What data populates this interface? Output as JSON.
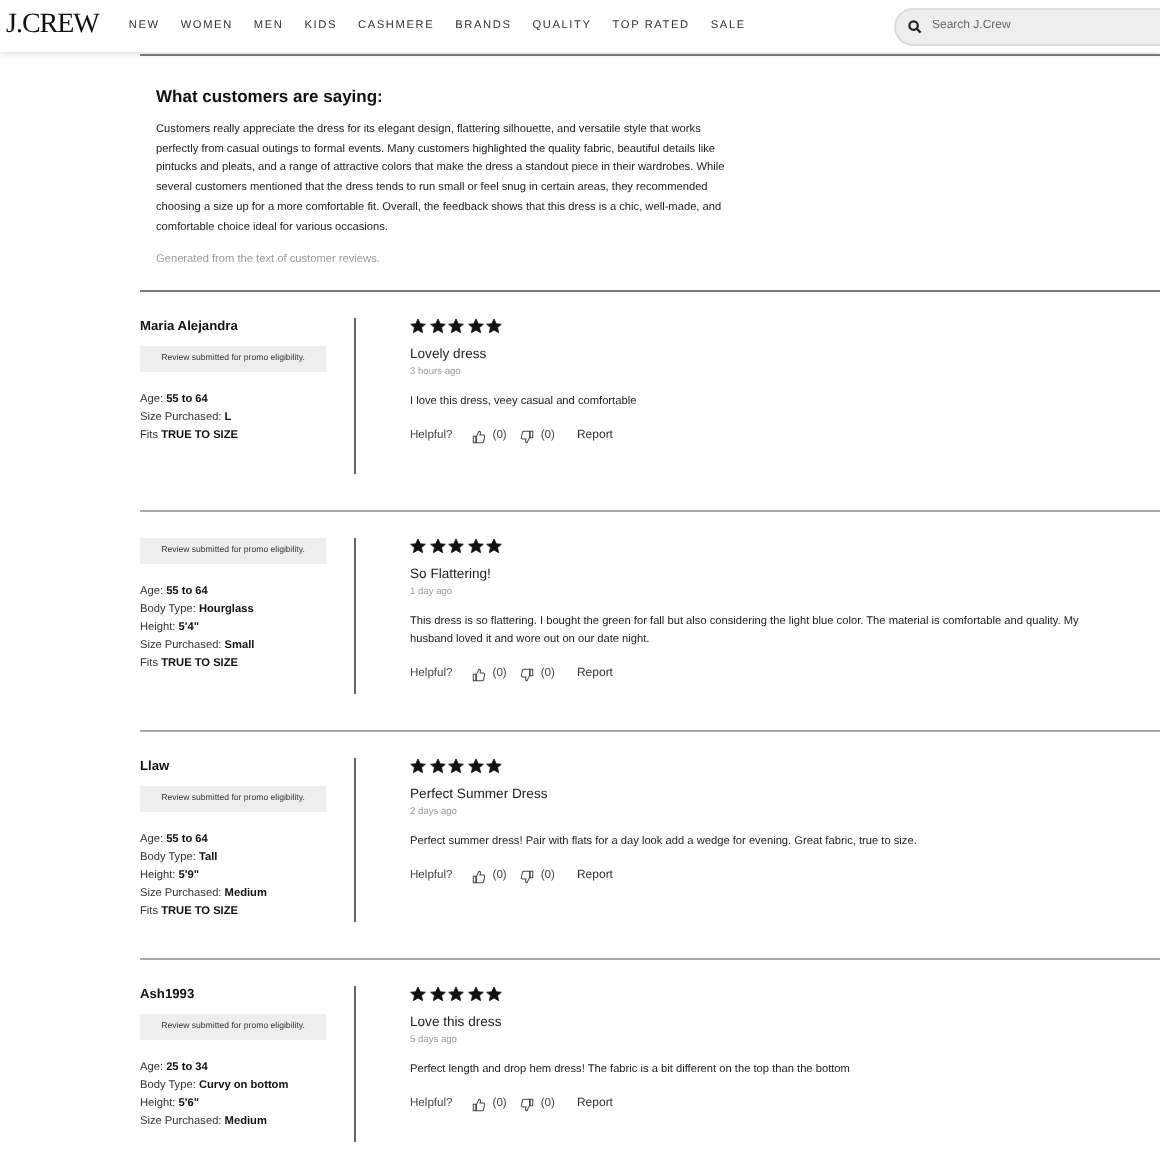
{
  "header": {
    "logo": "J.CREW",
    "nav": [
      "NEW",
      "WOMEN",
      "MEN",
      "KIDS",
      "CASHMERE",
      "BRANDS",
      "QUALITY",
      "TOP RATED",
      "SALE"
    ],
    "search": {
      "placeholder": "Search J.Crew"
    }
  },
  "summary": {
    "title": "What customers are saying:",
    "text": "Customers really appreciate the dress for its elegant design, flattering silhouette, and versatile style that works perfectly from casual outings to formal events. Many customers highlighted the quality fabric, beautiful details like pintucks and pleats, and a range of attractive colors that make the dress a standout piece in their wardrobes. While several customers mentioned that the dress tends to run small or feel snug in certain areas, they recommended choosing a size up for a more comfortable fit. Overall, the feedback shows that this dress is a chic, well-made, and comfortable choice ideal for various occasions.",
    "note": "Generated from the text of customer reviews."
  },
  "reviews": [
    {
      "author": "Maria Alejandra",
      "badge": "Review submitted for promo eligibility.",
      "attributes": [
        {
          "label": "Age:",
          "value": "55 to 64"
        },
        {
          "label": "Size Purchased:",
          "value": "L"
        },
        {
          "label": "Fits",
          "value": "TRUE TO SIZE"
        }
      ],
      "stars": 5,
      "title": "Lovely dress",
      "time": "3 hours ago",
      "text": "I love this dress, veey casual and comfortable",
      "helpful": "Helpful?",
      "up": "(0)",
      "down": "(0)",
      "report": "Report"
    },
    {
      "badge": "Review submitted for promo eligibility.",
      "attributes": [
        {
          "label": "Age:",
          "value": "55 to 64"
        },
        {
          "label": "Body Type:",
          "value": "Hourglass"
        },
        {
          "label": "Height:",
          "value": "5'4\""
        },
        {
          "label": "Size Purchased:",
          "value": "Small"
        },
        {
          "label": "Fits",
          "value": "TRUE TO SIZE"
        }
      ],
      "stars": 5,
      "title": "So Flattering!",
      "time": "1 day ago",
      "text": "This dress is so flattering. I bought the green for fall but also considering the light blue color. The material is comfortable and quality. My husband loved it and wore out on our date night.",
      "helpful": "Helpful?",
      "up": "(0)",
      "down": "(0)",
      "report": "Report"
    },
    {
      "author": "Llaw",
      "badge": "Review submitted for promo eligibility.",
      "attributes": [
        {
          "label": "Age:",
          "value": "55 to 64"
        },
        {
          "label": "Body Type:",
          "value": "Tall"
        },
        {
          "label": "Height:",
          "value": "5'9\""
        },
        {
          "label": "Size Purchased:",
          "value": "Medium"
        },
        {
          "label": "Fits",
          "value": "TRUE TO SIZE"
        }
      ],
      "stars": 5,
      "title": "Perfect Summer Dress",
      "time": "2 days ago",
      "text": "Perfect summer dress! Pair with flats for a day look add a wedge for evening. Great fabric, true to size.",
      "helpful": "Helpful?",
      "up": "(0)",
      "down": "(0)",
      "report": "Report"
    },
    {
      "author": "Ash1993",
      "badge": "Review submitted for promo eligibility.",
      "attributes": [
        {
          "label": "Age:",
          "value": "25 to 34"
        },
        {
          "label": "Body Type:",
          "value": "Curvy on bottom"
        },
        {
          "label": "Height:",
          "value": "5'6\""
        },
        {
          "label": "Size Purchased:",
          "value": "Medium"
        }
      ],
      "stars": 5,
      "title": "Love this dress",
      "time": "5 days ago",
      "text": "Perfect length and drop hem dress! The fabric is a bit different on the top than the bottom",
      "helpful": "Helpful?",
      "up": "(0)",
      "down": "(0)",
      "report": "Report"
    }
  ]
}
